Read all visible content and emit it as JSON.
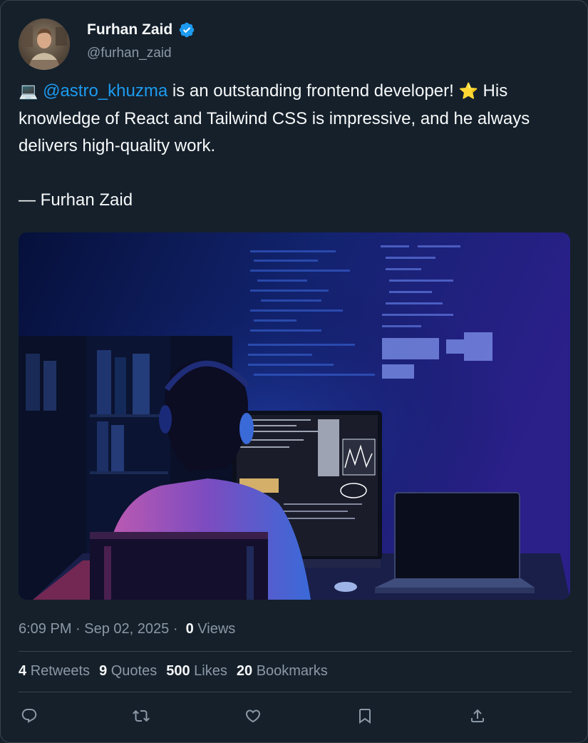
{
  "author": {
    "name": "Furhan Zaid",
    "handle": "@furhan_zaid",
    "verified": true
  },
  "tweet": {
    "emoji_start": "💻",
    "mention": "@astro_khuzma",
    "text_after_mention": " is an outstanding frontend developer! ",
    "emoji_mid": "⭐",
    "text_end": " His knowledge of React and Tailwind CSS is impressive, and he always delivers high-quality work.",
    "signature": "— Furhan Zaid"
  },
  "meta": {
    "time": "6:09 PM",
    "separator1": " · ",
    "date": "Sep 02, 2025",
    "separator2": " · ",
    "views_count": "0",
    "views_label": "Views"
  },
  "stats": [
    {
      "count": "4",
      "label": "Retweets"
    },
    {
      "count": "9",
      "label": "Quotes"
    },
    {
      "count": "500",
      "label": "Likes"
    },
    {
      "count": "20",
      "label": "Bookmarks"
    }
  ],
  "colors": {
    "background": "#15202b",
    "accent": "#1d9bf0",
    "muted": "#8b98a5",
    "border": "#38444d"
  }
}
